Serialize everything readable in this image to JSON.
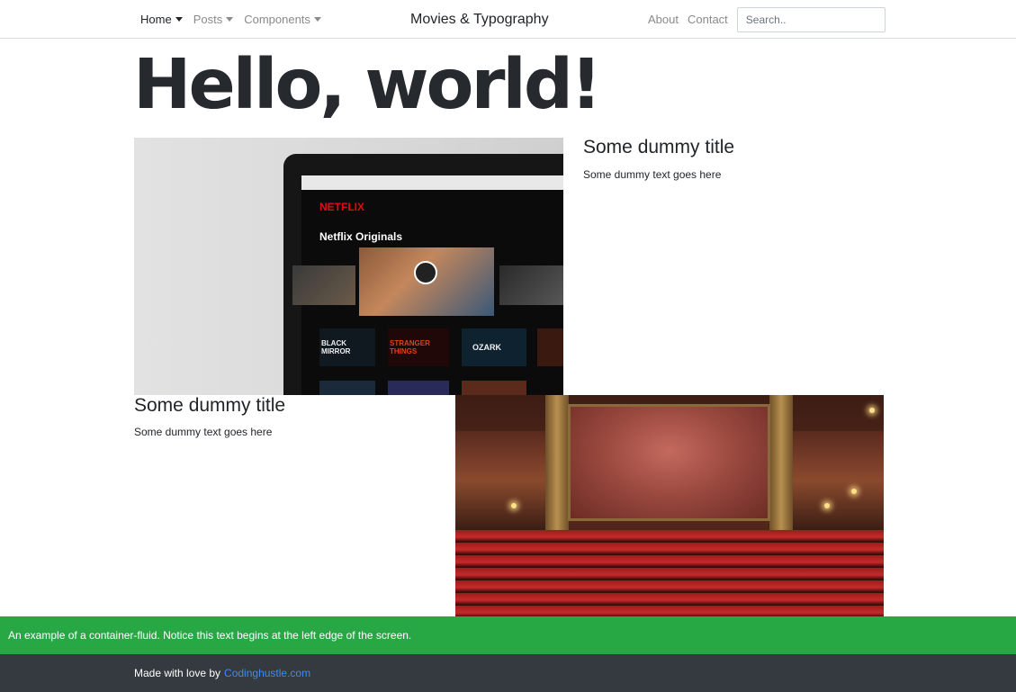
{
  "nav": {
    "brand": "Movies & Typography",
    "left": [
      {
        "label": "Home",
        "active": true
      },
      {
        "label": "Posts",
        "active": false
      },
      {
        "label": "Components",
        "active": false
      }
    ],
    "right": [
      {
        "label": "About"
      },
      {
        "label": "Contact"
      }
    ],
    "search_placeholder": "Search.."
  },
  "hero": {
    "heading": "Hello, world!"
  },
  "cards": [
    {
      "title": "Some dummy title",
      "text": "Some dummy text goes here",
      "image": "laptop-netflix-photo"
    },
    {
      "title": "Some dummy title",
      "text": "Some dummy text goes here",
      "image": "theater-stage-photo"
    }
  ],
  "netflix_screen": {
    "logo": "NETFLIX",
    "section": "Netflix Originals",
    "tiles": [
      "BLACK MIRROR",
      "STRANGER THINGS",
      "OZARK"
    ]
  },
  "green_bar": {
    "text": "An example of a container-fluid. Notice this text begins at the left edge of the screen."
  },
  "footer": {
    "prefix": "Made with love by",
    "link": "Codinghustle.com"
  },
  "colors": {
    "green": "#28a745",
    "dark": "#343a40",
    "link": "#3b8cf0",
    "netflix_red": "#e50914"
  }
}
